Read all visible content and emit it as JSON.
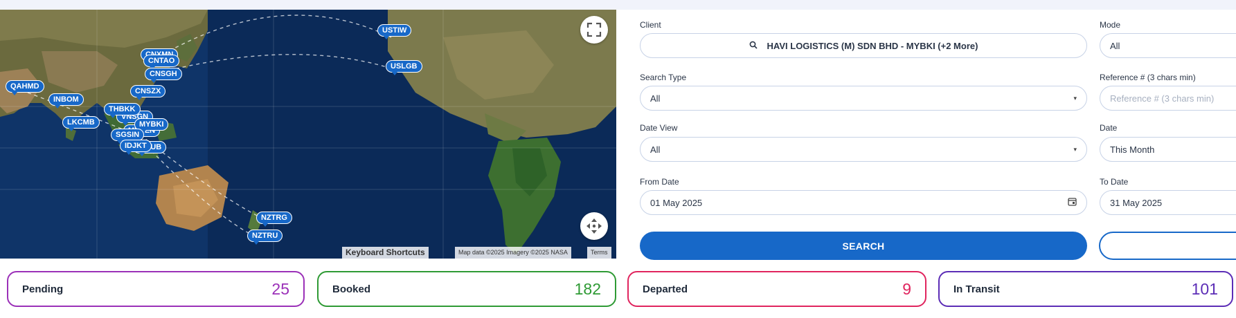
{
  "map": {
    "pins": [
      {
        "code": "CNTAO"
      },
      {
        "code": "CNXMN"
      },
      {
        "code": "CNSGH"
      },
      {
        "code": "QAHMD"
      },
      {
        "code": "INBOM"
      },
      {
        "code": "CNSZX"
      },
      {
        "code": "THBKK"
      },
      {
        "code": "VNSGN"
      },
      {
        "code": "LKCMB"
      },
      {
        "code": "MYBKI"
      },
      {
        "code": "MYPEN"
      },
      {
        "code": "SGSIN"
      },
      {
        "code": "IDJKT"
      },
      {
        "code": "IDSUB"
      },
      {
        "code": "USTIW"
      },
      {
        "code": "USLGB"
      },
      {
        "code": "NZTRG"
      },
      {
        "code": "NZTRU"
      }
    ],
    "attribution": {
      "shortcuts": "Keyboard Shortcuts",
      "data": "Map data ©2025 Imagery ©2025 NASA",
      "terms": "Terms"
    },
    "fullscreen_icon": "fullscreen-icon",
    "recenter_icon": "recenter-icon"
  },
  "filters": {
    "client": {
      "label": "Client",
      "value": "HAVI LOGISTICS (M) SDN BHD - MYBKI (+2 More)"
    },
    "mode": {
      "label": "Mode",
      "value": "All"
    },
    "search_type": {
      "label": "Search Type",
      "value": "All"
    },
    "reference": {
      "label": "Reference # (3 chars min)",
      "placeholder": "Reference # (3 chars min)"
    },
    "date_view": {
      "label": "Date View",
      "value": "All"
    },
    "date": {
      "label": "Date",
      "value": "This Month"
    },
    "from_date": {
      "label": "From Date",
      "value": "01 May 2025"
    },
    "to_date": {
      "label": "To Date",
      "value": "31 May 2025"
    },
    "search_button": "SEARCH"
  },
  "status_cards": [
    {
      "label": "Pending",
      "count": "25",
      "color": "#9b30b8"
    },
    {
      "label": "Booked",
      "count": "182",
      "color": "#2e9a34"
    },
    {
      "label": "Departed",
      "count": "9",
      "color": "#e0245e"
    },
    {
      "label": "In Transit",
      "count": "101",
      "color": "#5c2db6"
    }
  ]
}
